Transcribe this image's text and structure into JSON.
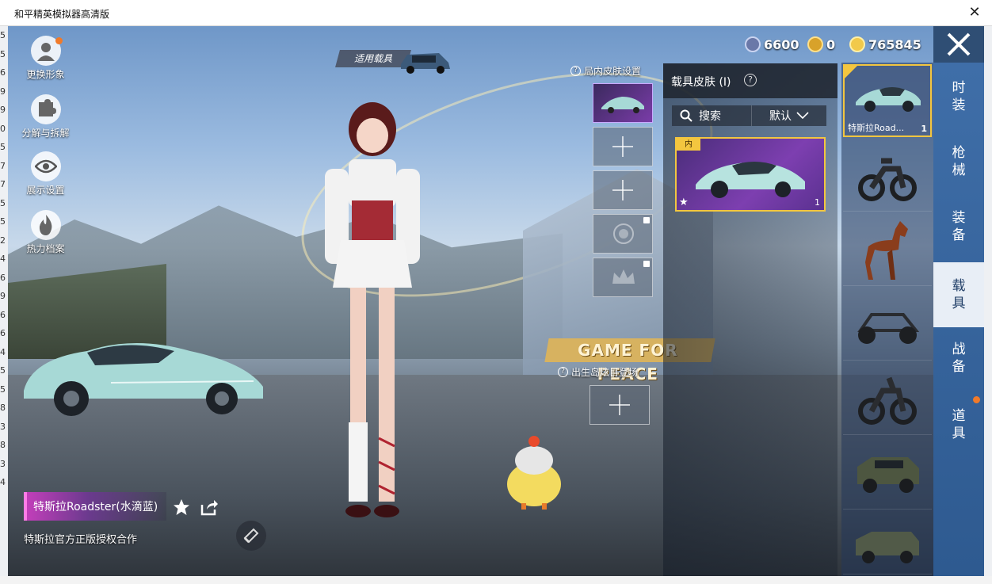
{
  "window": {
    "title": "和平精英模拟器高清版",
    "close_glyph": "✕"
  },
  "left_strip_digits": [
    "5",
    "5",
    "6",
    "9",
    "9",
    "0",
    "5",
    "7",
    "7",
    "5",
    "5",
    "2",
    "4",
    "6",
    "9",
    "6",
    "6",
    "4",
    "5",
    "5",
    "8",
    "3",
    "8",
    "3",
    "4"
  ],
  "left_menu": [
    {
      "label": "更换形象",
      "icon": "avatar-icon"
    },
    {
      "label": "分解与拆解",
      "icon": "puzzle-icon"
    },
    {
      "label": "展示设置",
      "icon": "eye-icon"
    },
    {
      "label": "热力档案",
      "icon": "flame-icon"
    }
  ],
  "vehicle_tag": {
    "label": "适用载具"
  },
  "currency": [
    {
      "value": "6600",
      "color": "#6a78a8"
    },
    {
      "value": "0",
      "color": "#d8a22a"
    },
    {
      "value": "765845",
      "color": "#f1c94a"
    }
  ],
  "skin_settings": {
    "label": "局内皮肤设置",
    "qm": "?"
  },
  "plane_settings": {
    "label": "出生岛炫目登场",
    "qm": "?"
  },
  "panel": {
    "title": "载具皮肤 (I)",
    "qm": "?",
    "search_label": "搜索",
    "sort_label": "默认",
    "card": {
      "tag": "内",
      "count": "1",
      "star": "★"
    }
  },
  "vehicles": [
    {
      "name": "特斯拉Road...",
      "count": "1",
      "icon": "tesla-icon"
    },
    {
      "name": "",
      "count": "",
      "icon": "motorcycle-icon"
    },
    {
      "name": "",
      "count": "",
      "icon": "horse-icon"
    },
    {
      "name": "",
      "count": "",
      "icon": "buggy-icon"
    },
    {
      "name": "",
      "count": "",
      "icon": "motorcycle2-icon"
    },
    {
      "name": "",
      "count": "",
      "icon": "jeep-icon"
    },
    {
      "name": "",
      "count": "",
      "icon": "truck-icon"
    }
  ],
  "categories": [
    "时装",
    "枪械",
    "装备",
    "载具",
    "战备",
    "道具"
  ],
  "selected_category": 3,
  "bottom": {
    "vehicle_name": "特斯拉Roadster(水滴蓝)",
    "licence": "特斯拉官方正版授权合作"
  },
  "banner_text": "GAME FOR PEACE"
}
